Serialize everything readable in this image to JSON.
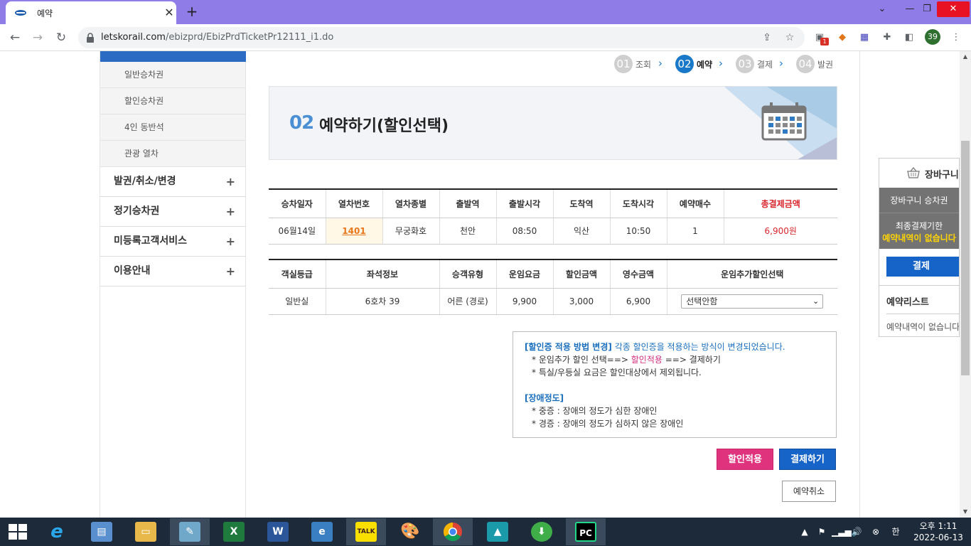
{
  "browser": {
    "tab_title": "예약",
    "url_host": "letskorail.com",
    "url_path": "/ebizprd/EbizPrdTicketPr12111_i1.do",
    "extension_badge": "1",
    "profile_count": "39"
  },
  "sidebar": {
    "sub_items": [
      "일반승차권",
      "할인승차권",
      "4인 동반석",
      "관광 열차"
    ],
    "main_items": [
      "발권/취소/변경",
      "정기승차권",
      "미등록고객서비스",
      "이용안내"
    ],
    "plus": "+"
  },
  "steps": [
    {
      "num": "01",
      "label": "조회"
    },
    {
      "num": "02",
      "label": "예약"
    },
    {
      "num": "03",
      "label": "결제"
    },
    {
      "num": "04",
      "label": "발권"
    }
  ],
  "banner": {
    "num": "02",
    "title": "예약하기(할인선택)"
  },
  "journey_table": {
    "headers": [
      "승차일자",
      "열차번호",
      "열차종별",
      "출발역",
      "출발시각",
      "도착역",
      "도착시각",
      "예약매수",
      "총결제금액"
    ],
    "row": [
      "06월14일",
      "1401",
      "무궁화호",
      "천안",
      "08:50",
      "익산",
      "10:50",
      "1",
      "6,900원"
    ]
  },
  "fare_table": {
    "headers": [
      "객실등급",
      "좌석정보",
      "승객유형",
      "운임요금",
      "할인금액",
      "영수금액",
      "운임추가할인선택"
    ],
    "row": [
      "일반실",
      "6호차 39",
      "어른 (경로)",
      "9,900",
      "3,000",
      "6,900"
    ],
    "select_value": "선택안함"
  },
  "notice": {
    "heading1": "[할인증 적용 방법 변경]",
    "heading1_rest": " 각종 할인증을 적용하는 방식이 변경되었습니다.",
    "line1_pre": "* 운임추가 할인 선택==> ",
    "line1_pink": "할인적용",
    "line1_post": " ==> 결제하기",
    "line2": "* 특실/우등실 요금은 할인대상에서 제외됩니다.",
    "heading2": "[장애정도]",
    "line3": "* 중증 : 장애의 정도가 심한 장애인",
    "line4": "* 경증 : 장애의 정도가 심하지 않은 장애인"
  },
  "buttons": {
    "apply_discount": "할인적용",
    "pay": "결제하기",
    "cancel": "예약취소"
  },
  "cart": {
    "title": "장바구니",
    "gray_line1": "장바구니 승차권",
    "gray_line2": "최종결제기한",
    "gray_line3": "예약내역이 없습니다",
    "pay": "결제",
    "list_title": "예약리스트",
    "empty": "예약내역이 없습니다"
  },
  "taskbar": {
    "apps": [
      "ie",
      "control-panel",
      "explorer",
      "notepad",
      "excel",
      "word",
      "ie-tool",
      "kakaotalk",
      "paint",
      "chrome",
      "photo",
      "install",
      "pycharm"
    ],
    "ime": "한",
    "time": "오후 1:11",
    "date": "2022-06-13",
    "kakao": "TALK",
    "pycharm": "PC"
  }
}
